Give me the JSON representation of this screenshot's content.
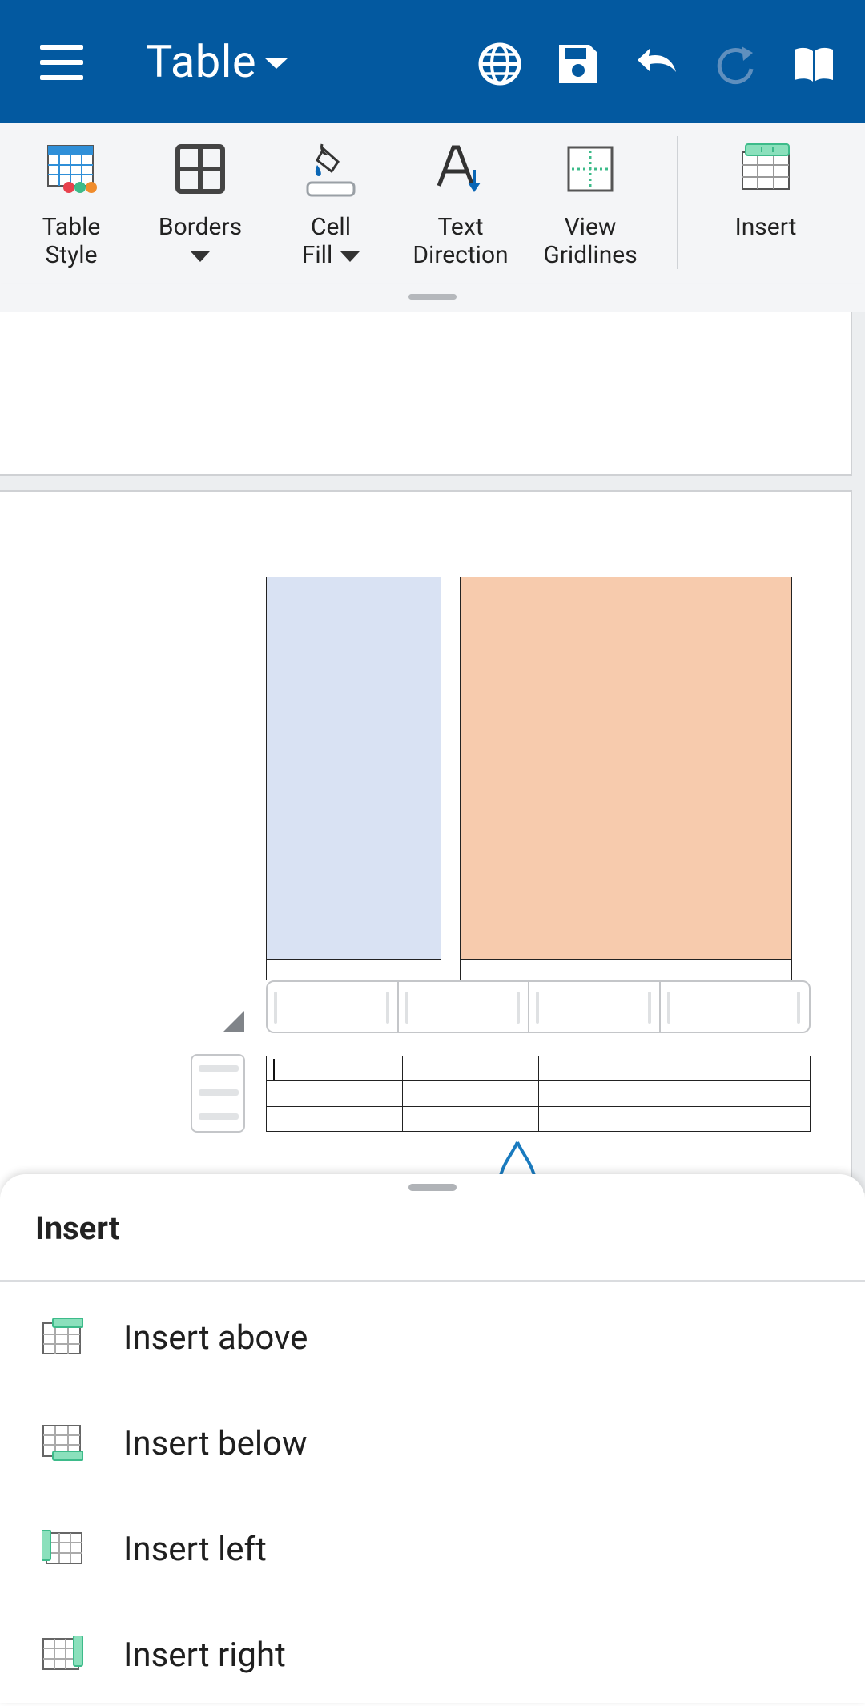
{
  "appbar": {
    "title": "Table",
    "icons": [
      "menu-icon",
      "globe-icon",
      "save-icon",
      "undo-icon",
      "redo-icon",
      "read-mode-icon"
    ]
  },
  "ribbon": {
    "items": [
      {
        "label_line1": "Table",
        "label_line2": "Style",
        "icon": "table-style-icon"
      },
      {
        "label_line1": "Borders",
        "label_line2": "",
        "icon": "borders-icon",
        "has_dropdown": true
      },
      {
        "label_line1": "Cell",
        "label_line2": "Fill",
        "icon": "cell-fill-icon",
        "has_dropdown": true
      },
      {
        "label_line1": "Text",
        "label_line2": "Direction",
        "icon": "text-direction-icon"
      },
      {
        "label_line1": "View",
        "label_line2": "Gridlines",
        "icon": "view-gridlines-icon"
      },
      {
        "label_line1": "Insert",
        "label_line2": "",
        "icon": "insert-table-icon"
      }
    ]
  },
  "colors": {
    "appbar": "#0359a0",
    "cell_blue": "#d9e2f3",
    "cell_orange": "#f7cbad",
    "accent_green": "#3dbb8a"
  },
  "sheet": {
    "title": "Insert",
    "items": [
      {
        "label": "Insert above",
        "icon": "insert-above-icon"
      },
      {
        "label": "Insert below",
        "icon": "insert-below-icon"
      },
      {
        "label": "Insert left",
        "icon": "insert-left-icon"
      },
      {
        "label": "Insert right",
        "icon": "insert-right-icon"
      }
    ]
  }
}
